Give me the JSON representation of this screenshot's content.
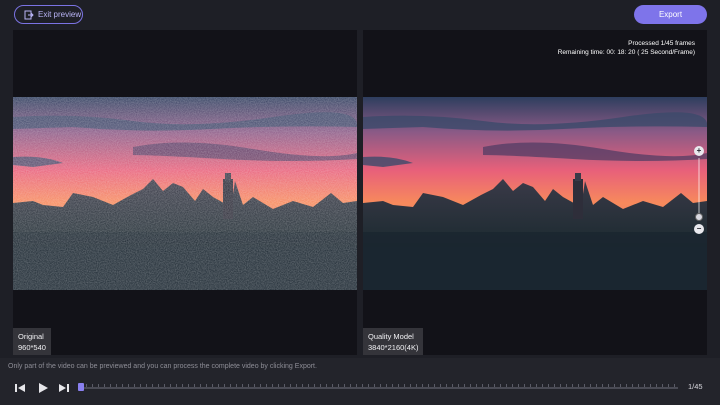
{
  "header": {
    "exit_label": "Exit preview",
    "export_label": "Export"
  },
  "left_panel": {
    "title": "Original",
    "resolution": "960*540"
  },
  "right_panel": {
    "title": "Quality Model",
    "resolution": "3840*2160(4K)",
    "processed_text": "Processed 1/45 frames",
    "remaining_text": "Remaining time: 00: 18: 20 ( 25 Second/Frame)"
  },
  "zoom": {
    "plus_icon": "plus-icon",
    "minus_icon": "minus-icon",
    "level": 0.95
  },
  "footer": {
    "hint": "Only part of the video can be previewed and you can process the complete video by clicking Export.",
    "frame_counter": "1/45",
    "progress": 0.0
  },
  "colors": {
    "accent": "#7e74ea",
    "background": "#1e1f26"
  }
}
